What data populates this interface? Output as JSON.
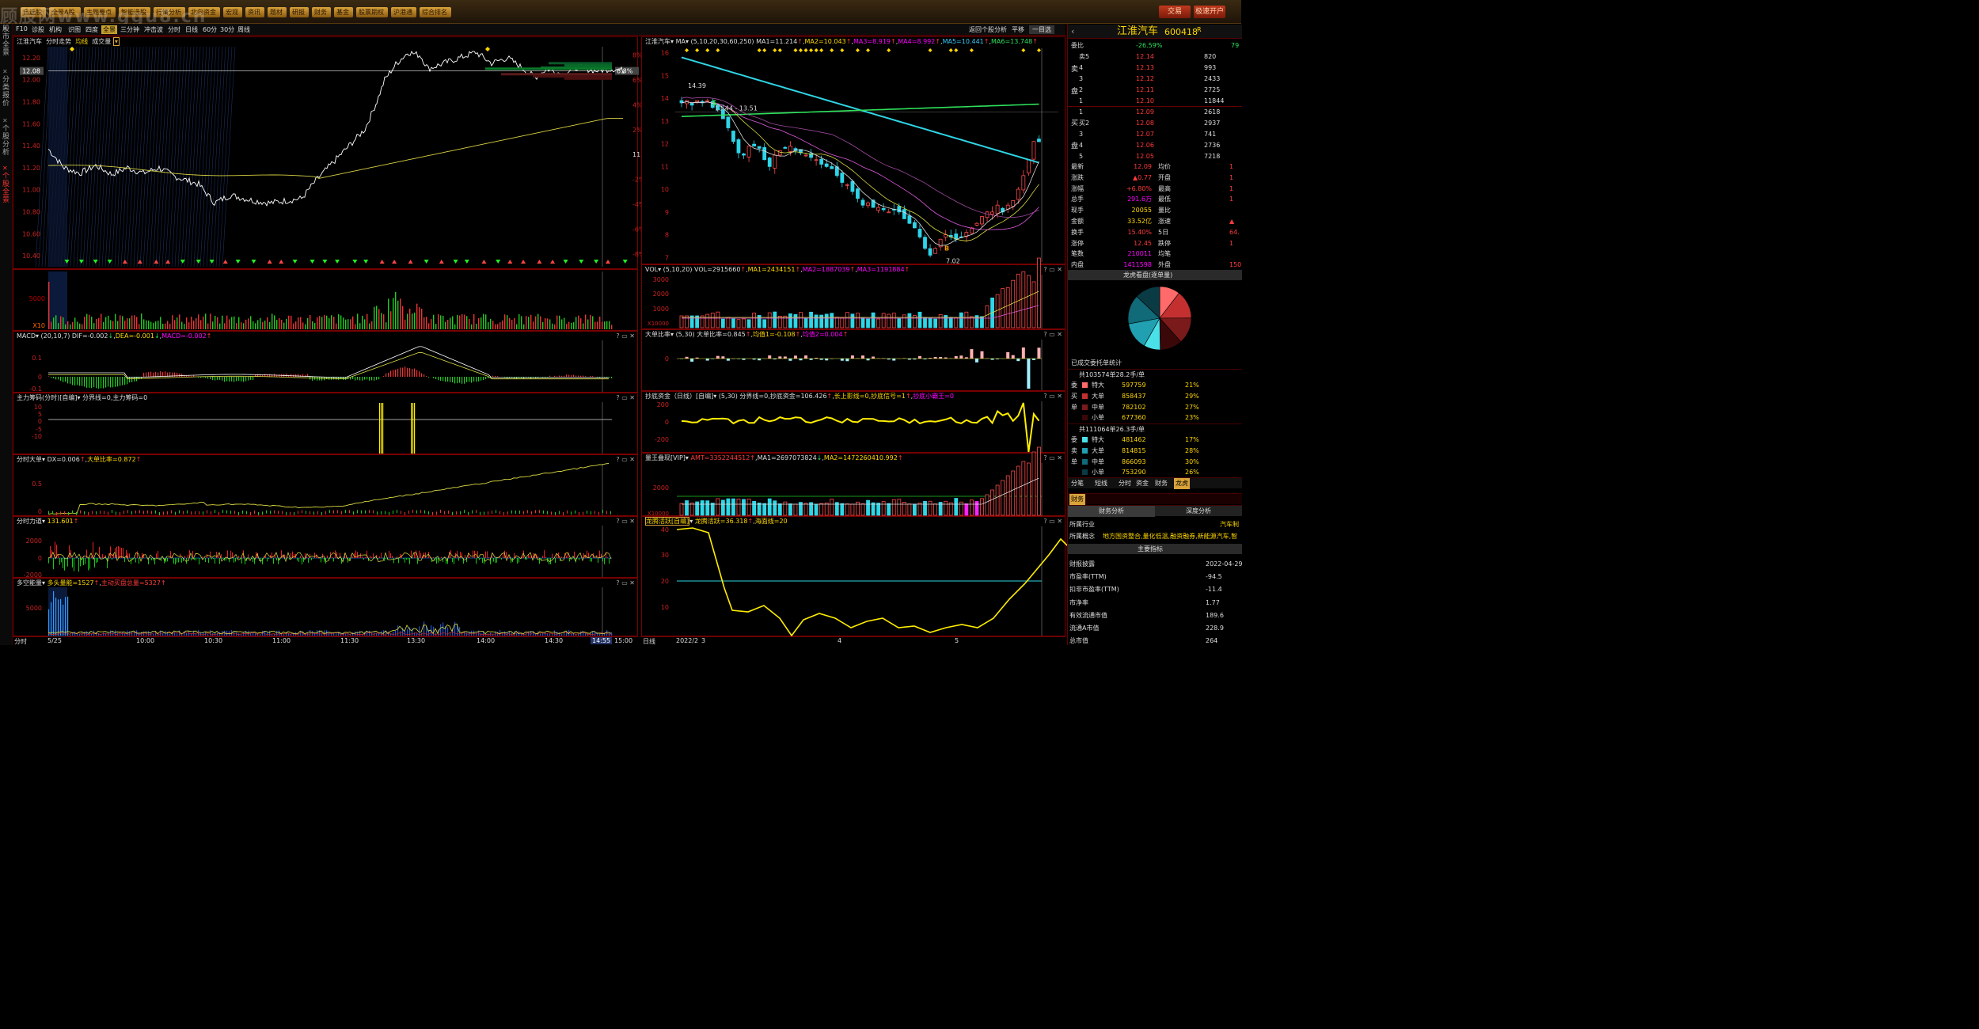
{
  "topbar": {
    "buttons": [
      "自选股",
      "全景A股",
      "主题要点",
      "智能选股",
      "行情分析",
      "北向资金",
      "宏观",
      "资讯",
      "题材",
      "研报",
      "财务",
      "基金",
      "股票期权",
      "沪港通",
      "综合排名"
    ],
    "right_buttons": [
      "交易",
      "极速开户"
    ],
    "watermark": "顾股网www.ggu8.cn"
  },
  "leftrail": {
    "items": [
      "股市全景",
      "分类报价",
      "个股分析",
      "个股全景"
    ]
  },
  "subbar": {
    "items": [
      "F10",
      "诊股",
      "机构",
      "识图",
      "四度",
      "全景",
      "三分钟",
      "冲击波",
      "分时",
      "日线",
      "60分",
      "30分",
      "周线"
    ],
    "active": "全景",
    "right": [
      "返回个股分析",
      "平移",
      "一目选"
    ]
  },
  "intraday": {
    "header": [
      "江淮汽车",
      "分时走势",
      "均线",
      "成交量"
    ],
    "price_axis": [
      "12.20",
      "12.00",
      "11.80",
      "11.60",
      "11.40",
      "11.20",
      "11.00",
      "10.80",
      "10.60",
      "10.40"
    ],
    "pct_axis": [
      "8%",
      "6%",
      "4%",
      "2%",
      "0%",
      "-2%",
      "-4%",
      "-6%",
      "-8%"
    ],
    "current_price": "12.08",
    "current_pct": "6.8%",
    "prev_close": "11.32",
    "time_axis": [
      "分时",
      "5/25",
      "10:00",
      "10:30",
      "11:00",
      "11:30",
      "13:30",
      "14:00",
      "14:30",
      "14:55",
      "15:00"
    ],
    "vol_axis": [
      "5000"
    ],
    "vol_unit": "X10",
    "macd": {
      "title": "MACD",
      "params": "(20,10,7)",
      "dif": "DIF=-0.002",
      "dea": "DEA=-0.001",
      "macd": "MACD=-0.002",
      "axis": [
        "0.1",
        "0",
        "-0.1"
      ]
    },
    "main_chip": {
      "title": "主力筹码(分时)[自编]",
      "text": "分界线=0,主力筹码=0",
      "axis": [
        "10",
        "5",
        "0",
        "-5",
        "-10"
      ]
    },
    "big_order": {
      "title": "分时大单",
      "text": "DX=0.006",
      "text2": "大单比率=0.872",
      "axis": [
        "0.5",
        "0"
      ]
    },
    "force": {
      "title": "分时力道",
      "text": "131.601",
      "axis": [
        "2000",
        "0",
        "-2000"
      ]
    },
    "long_short": {
      "title": "多空能量",
      "text": "多头量能=1527",
      "text2": "主动买盘总量=5327",
      "axis": [
        "5000"
      ]
    }
  },
  "daily": {
    "header": {
      "name": "江淮汽车",
      "ma": "MA",
      "params": "(5,10,20,30,60,250)",
      "ma1": "MA1=11.214",
      "ma2": "MA2=10.043",
      "ma3": "MA3=8.919",
      "ma4": "MA4=8.992",
      "ma5": "MA5=10.441",
      "ma6": "MA6=13.748"
    },
    "price_axis": [
      "16",
      "15",
      "14",
      "13",
      "12",
      "11",
      "10",
      "9",
      "8",
      "7"
    ],
    "annot": [
      "14.39",
      "13.44 - 13.51",
      "7.02"
    ],
    "vol": {
      "title": "VOL",
      "params": "(5,10,20)",
      "text": "VOL=2915660",
      "ma1": "MA1=2434151",
      "ma2": "MA2=1887039",
      "ma3": "MA3=1191884",
      "axis": [
        "3000",
        "2000",
        "1000"
      ],
      "unit": "X10000"
    },
    "bigratio": {
      "title": "大单比率",
      "params": "(5,30)",
      "text": "大单比率=0.845",
      "t2": "均值1=-0.108",
      "t3": "均值2=0.004",
      "axis": [
        "0"
      ]
    },
    "bottom": {
      "title": "抄底资金（日线）[自编]",
      "params": "(5,30)",
      "text": "分界线=0,抄底资金=106.426",
      "t2": "长上影线=0,抄底信号=1",
      "t3": "抄底小霸王=0",
      "axis": [
        "200",
        "0",
        "-200"
      ]
    },
    "volking": {
      "title": "量王叠现[VIP]",
      "t1": "AMT=3352244512",
      "t2": "MA1=2697073824",
      "t3": "MA2=1472260410.992",
      "axis": [
        "2000"
      ],
      "unit": "X10000"
    },
    "dragon": {
      "title": "龙腾活跃[自编]",
      "text": "龙腾活跃=36.318",
      "t2": "海面线=20",
      "axis": [
        "40",
        "30",
        "20",
        "10"
      ]
    },
    "time_axis": [
      "日线",
      "2022/2",
      "3",
      "4",
      "5"
    ]
  },
  "right": {
    "title": "江淮汽车",
    "code": "600418",
    "mark": "R",
    "wei": {
      "label": "委比",
      "pct": "-26.59%",
      "diff": "79"
    },
    "asks": [
      {
        "l": "卖5",
        "p": "12.14",
        "v": "820"
      },
      {
        "l": "4",
        "p": "12.13",
        "v": "993"
      },
      {
        "l": "3",
        "p": "12.12",
        "v": "2433"
      },
      {
        "l": "2",
        "p": "12.11",
        "v": "2725"
      },
      {
        "l": "1",
        "p": "12.10",
        "v": "11844"
      }
    ],
    "bids": [
      {
        "l": "1",
        "p": "12.09",
        "v": "2618"
      },
      {
        "l": "买2",
        "p": "12.08",
        "v": "2937"
      },
      {
        "l": "3",
        "p": "12.07",
        "v": "741"
      },
      {
        "l": "4",
        "p": "12.06",
        "v": "2736"
      },
      {
        "l": "5",
        "p": "12.05",
        "v": "7218"
      }
    ],
    "side_labels": [
      "卖",
      "盘",
      "买",
      "盘"
    ],
    "quote": [
      {
        "k": "最新",
        "v": "12.09",
        "k2": "均价",
        "v2": "1"
      },
      {
        "k": "涨跌",
        "v": "▲0.77",
        "k2": "开盘",
        "v2": "1"
      },
      {
        "k": "涨幅",
        "v": "+6.80%",
        "k2": "最高",
        "v2": "1"
      },
      {
        "k": "总手",
        "v": "291.6万",
        "k2": "最低",
        "v2": "1"
      },
      {
        "k": "现手",
        "v": "20055",
        "k2": "量比",
        "v2": ""
      },
      {
        "k": "金额",
        "v": "33.52亿",
        "k2": "涨速",
        "v2": "▲"
      },
      {
        "k": "换手",
        "v": "15.40%",
        "k2": "5日",
        "v2": "64."
      },
      {
        "k": "涨停",
        "v": "12.45",
        "k2": "跌停",
        "v2": "1"
      },
      {
        "k": "笔数",
        "v": "210011",
        "k2": "均笔",
        "v2": ""
      },
      {
        "k": "内盘",
        "v": "1411598",
        "k2": "外盘",
        "v2": "150"
      }
    ],
    "dragon_title": "龙虎看盘(逐单量)",
    "stat_title": "已成交委托单统计",
    "buy_head": "共103574单28.2手/单",
    "buy_side": [
      "委",
      "买",
      "单"
    ],
    "buy": [
      {
        "k": "特大",
        "v": "597759",
        "p": "21%"
      },
      {
        "k": "大单",
        "v": "858437",
        "p": "29%"
      },
      {
        "k": "中单",
        "v": "782102",
        "p": "27%"
      },
      {
        "k": "小单",
        "v": "677360",
        "p": "23%"
      }
    ],
    "sell_head": "共111064单26.3手/单",
    "sell_side": [
      "委",
      "卖",
      "单"
    ],
    "sell": [
      {
        "k": "特大",
        "v": "481462",
        "p": "17%"
      },
      {
        "k": "大单",
        "v": "814815",
        "p": "28%"
      },
      {
        "k": "中单",
        "v": "866093",
        "p": "30%"
      },
      {
        "k": "小单",
        "v": "753290",
        "p": "26%"
      }
    ],
    "tabs": [
      "分笔",
      "短线",
      "分时",
      "资金",
      "财务",
      "龙虎"
    ],
    "tab_active": "龙虎",
    "fin_tab": "财务",
    "fin_sub": [
      "财务分析",
      "深度分析"
    ],
    "industry": {
      "k": "所属行业",
      "v": "汽车制"
    },
    "concept": {
      "k": "所属概念",
      "v": "地方国资整合,量化低温,融资融券,新能源汽车,智"
    },
    "main_idx": "主要指标",
    "fin": [
      {
        "k": "财报披露",
        "v": "2022-04-29"
      },
      {
        "k": "市盈率(TTM)",
        "v": "-94.5"
      },
      {
        "k": "扣非市盈率(TTM)",
        "v": "-11.4"
      },
      {
        "k": "市净率",
        "v": "1.77"
      },
      {
        "k": "有效流通市值",
        "v": "189.6"
      },
      {
        "k": "流通A市值",
        "v": "228.9"
      },
      {
        "k": "总市值",
        "v": "264"
      }
    ]
  }
}
